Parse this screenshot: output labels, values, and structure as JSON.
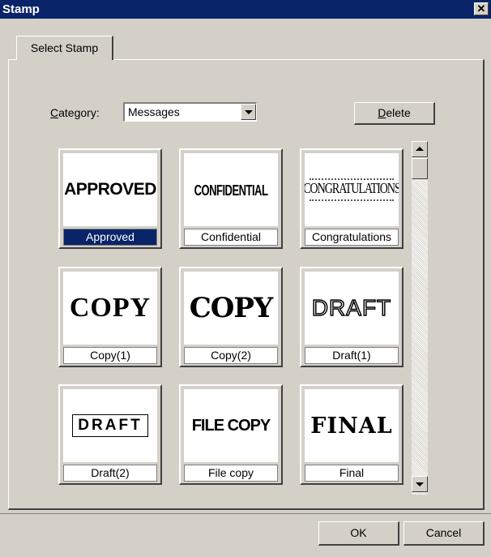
{
  "window": {
    "title": "Stamp",
    "close_symbol": "✕"
  },
  "tabs": [
    {
      "label": "Select Stamp"
    }
  ],
  "category": {
    "label_accel": "C",
    "label_rest": "ategory:",
    "value": "Messages"
  },
  "buttons": {
    "delete_accel": "D",
    "delete_rest": "elete",
    "ok": "OK",
    "cancel": "Cancel"
  },
  "stamps": [
    {
      "name": "Approved",
      "preview": "APPROVED",
      "selected": true
    },
    {
      "name": "Confidential",
      "preview": "CONFIDENTIAL"
    },
    {
      "name": "Congratulations",
      "preview": "CONGRATULATIONS"
    },
    {
      "name": "Copy(1)",
      "preview": "COPY"
    },
    {
      "name": "Copy(2)",
      "preview": "COPY"
    },
    {
      "name": "Draft(1)",
      "preview": "DRAFT"
    },
    {
      "name": "Draft(2)",
      "preview": "DRAFT"
    },
    {
      "name": "File copy",
      "preview": "FILE COPY"
    },
    {
      "name": "Final",
      "preview": "FINAL"
    }
  ]
}
